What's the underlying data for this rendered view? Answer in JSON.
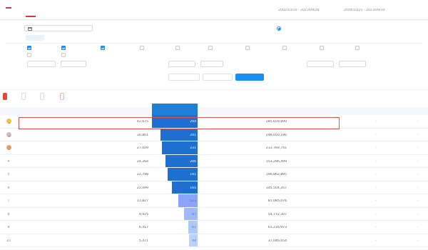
{
  "header": {
    "title": "",
    "tabs": [
      "",
      ""
    ],
    "stats_label_1": "",
    "stats_range_1": "2002/10/10 - 2023/09/28",
    "stats_label_2": "",
    "stats_range_2": "2004/10/21 - 2023/09/30",
    "stats_label_3": "",
    "stats_value_3": ""
  },
  "filters": {
    "time_label": "",
    "date_range": "",
    "area_label": "",
    "area_option": "",
    "property_type_label": "",
    "type_chips": [
      "",
      "",
      "",
      ""
    ],
    "checkboxes_row1": [
      {
        "label": "",
        "checked": true
      },
      {
        "label": "",
        "checked": true
      },
      {
        "label": "",
        "checked": true
      },
      {
        "label": "",
        "checked": false
      },
      {
        "label": "",
        "checked": false
      },
      {
        "label": "",
        "checked": false
      },
      {
        "label": "",
        "checked": false
      },
      {
        "label": "",
        "checked": false
      },
      {
        "label": "",
        "checked": false
      },
      {
        "label": "",
        "checked": false
      }
    ],
    "checkboxes_row2": [
      {
        "label": "",
        "checked": false
      },
      {
        "label": "",
        "checked": false
      }
    ],
    "range_fields": [
      {
        "label": "",
        "unit": ""
      },
      {
        "label": "",
        "unit": ""
      },
      {
        "label": "",
        "unit": ""
      }
    ],
    "range_dash": "-",
    "buttons": {
      "btn_1": "",
      "btn_2": "",
      "confirm": ""
    }
  },
  "toolbar": {
    "btn_1": "",
    "btn_2": "",
    "btn_3": "",
    "btn_4": "",
    "export": ""
  },
  "table": {
    "columns": [
      "",
      "",
      "",
      "",
      "",
      "",
      "",
      "",
      "",
      ""
    ],
    "rows": [
      {
        "rank": "1",
        "medal": "#f1c232",
        "name": "",
        "sub": "",
        "c1": "42,675",
        "c2": 294,
        "c3": "",
        "c4": "285,659,890",
        "c5": "",
        "c6": "-",
        "c7": "-"
      },
      {
        "rank": "2",
        "medal": "#c0c0c0",
        "name": "",
        "sub": "",
        "c1": "30,861",
        "c2": 241,
        "c3": "",
        "c4": "246,050,196",
        "c5": "",
        "c6": "-",
        "c7": "-"
      },
      {
        "rank": "3",
        "medal": "#d8a26a",
        "name": "",
        "sub": "",
        "c1": "27,009",
        "c2": 231,
        "c3": "",
        "c4": "213,769,741",
        "c5": "",
        "c6": "-",
        "c7": "-"
      },
      {
        "rank": "4",
        "medal": "",
        "name": "",
        "sub": "",
        "c1": "24,264",
        "c2": 206,
        "c3": "",
        "c4": "153,296,499",
        "c5": "",
        "c6": "-",
        "c7": "-"
      },
      {
        "rank": "5",
        "medal": "",
        "name": "",
        "sub": "",
        "c1": "22,798",
        "c2": 191,
        "c3": "",
        "c4": "190,862,895",
        "c5": "",
        "c6": "-",
        "c7": "-"
      },
      {
        "rank": "6",
        "medal": "",
        "name": "",
        "sub": "",
        "c1": "22,099",
        "c2": 165,
        "c3": "",
        "c4": "145,504,357",
        "c5": "",
        "c6": "-",
        "c7": "-"
      },
      {
        "rank": "7",
        "medal": "",
        "name": "",
        "sub": "",
        "c1": "11,827",
        "c2": 123,
        "c3": "",
        "c4": "81,085,076",
        "c5": "",
        "c6": "-",
        "c7": "-"
      },
      {
        "rank": "8",
        "medal": "",
        "name": "",
        "sub": "",
        "c1": "9,925",
        "c2": 87,
        "c3": "",
        "c4": "54,772,307",
        "c5": "",
        "c6": "-",
        "c7": "-"
      },
      {
        "rank": "9",
        "medal": "",
        "name": "",
        "sub": "",
        "c1": "6,417",
        "c2": 61,
        "c3": "",
        "c4": "61,216,973",
        "c5": "",
        "c6": "-",
        "c7": "-"
      },
      {
        "rank": "10",
        "medal": "",
        "name": "",
        "sub": "",
        "c1": "5,471",
        "c2": 44,
        "c3": "",
        "c4": "37,046,654",
        "c5": "",
        "c6": "-",
        "c7": "-"
      }
    ]
  },
  "colors": {
    "accent": "#d23b3b",
    "primary": "#1b8ef2",
    "highlight": "#d9534f"
  }
}
